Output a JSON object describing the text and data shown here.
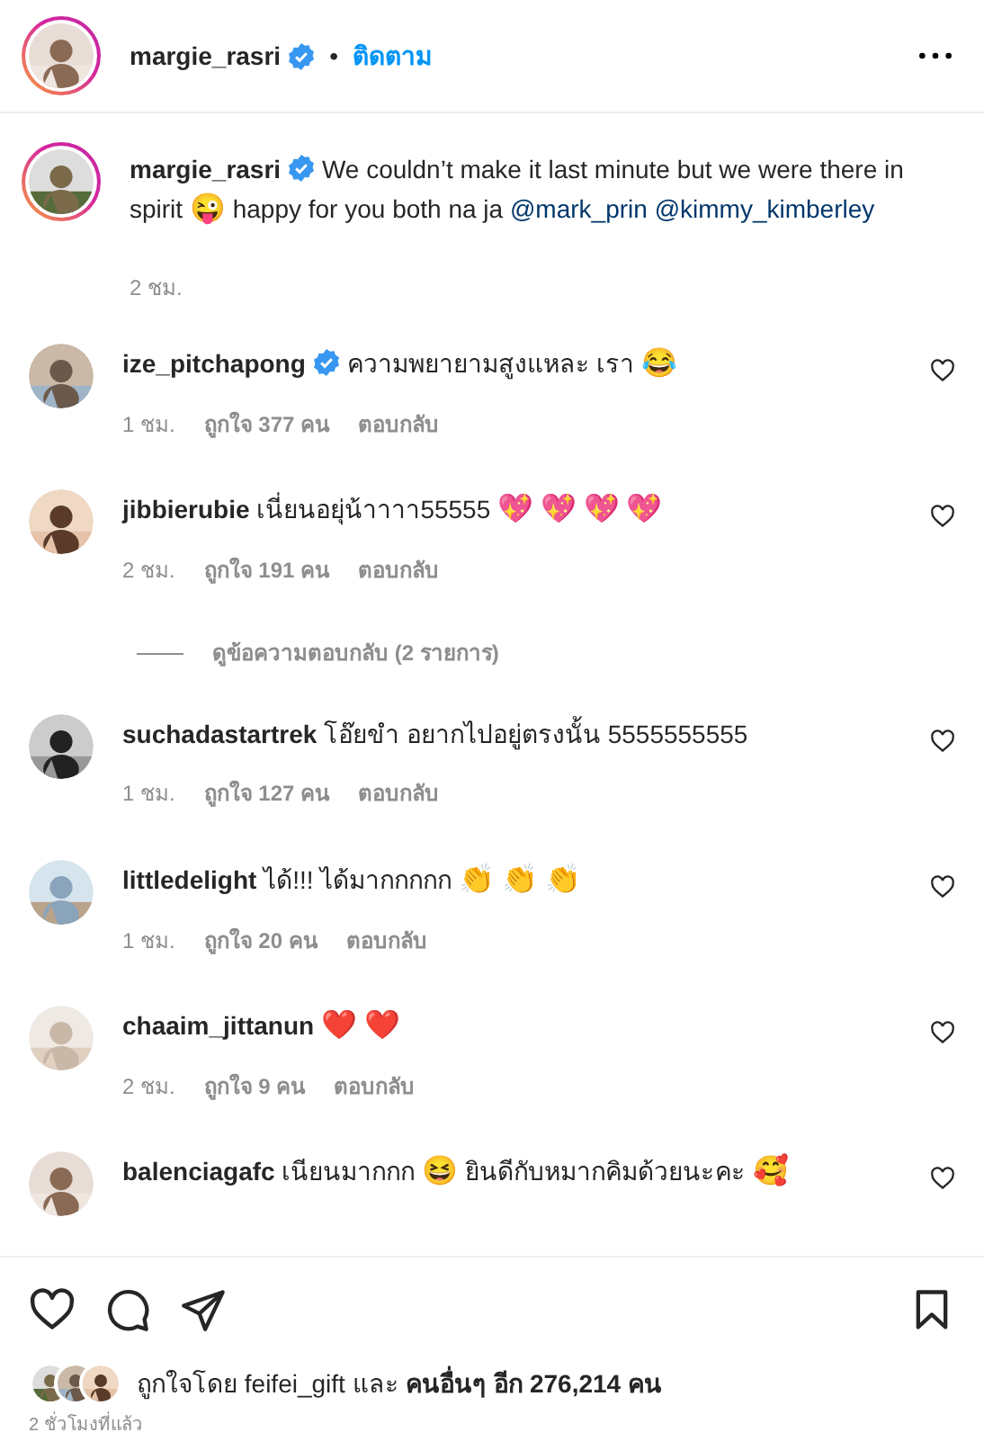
{
  "header": {
    "username": "margie_rasri",
    "verified": true,
    "separator": "•",
    "follow": "ติดตาม"
  },
  "caption": {
    "username": "margie_rasri",
    "verified": true,
    "parts": [
      {
        "kind": "text",
        "text": "We couldn’t make it last minute but we were there in spirit"
      },
      {
        "kind": "emoji",
        "emoji": "😜"
      },
      {
        "kind": "text",
        "text": "happy for you both na ja"
      },
      {
        "kind": "mention",
        "text": "@mark_prin"
      },
      {
        "kind": "mention",
        "text": "@kimmy_kimberley"
      }
    ],
    "time": "2 ชม."
  },
  "comments": [
    {
      "username": "ize_pitchapong",
      "verified": true,
      "parts": [
        {
          "kind": "text",
          "text": "ความพยายามสูงแหละ เรา"
        },
        {
          "kind": "emoji",
          "emoji": "😂"
        }
      ],
      "time": "1 ชม.",
      "likes": "ถูกใจ 377 คน",
      "reply": "ตอบกลับ"
    },
    {
      "username": "jibbierubie",
      "verified": false,
      "parts": [
        {
          "kind": "text",
          "text": "เนี่ยนอยุ่น้าาาา55555"
        },
        {
          "kind": "emoji",
          "emoji": "💖"
        },
        {
          "kind": "emoji",
          "emoji": "💖"
        },
        {
          "kind": "emoji",
          "emoji": "💖"
        },
        {
          "kind": "emoji",
          "emoji": "💖"
        }
      ],
      "time": "2 ชม.",
      "likes": "ถูกใจ 191 คน",
      "reply": "ตอบกลับ",
      "view_replies": "ดูข้อความตอบกลับ (2 รายการ)"
    },
    {
      "username": "suchadastartrek",
      "verified": false,
      "parts": [
        {
          "kind": "text",
          "text": "โอ๊ยขำ อยากไปอยู่ตรงนั้น 5555555555"
        }
      ],
      "time": "1 ชม.",
      "likes": "ถูกใจ 127 คน",
      "reply": "ตอบกลับ"
    },
    {
      "username": "littledelight",
      "verified": false,
      "parts": [
        {
          "kind": "text",
          "text": "ได้!!! ได้มากกกกก"
        },
        {
          "kind": "emoji",
          "emoji": "👏"
        },
        {
          "kind": "emoji",
          "emoji": "👏"
        },
        {
          "kind": "emoji",
          "emoji": "👏"
        }
      ],
      "time": "1 ชม.",
      "likes": "ถูกใจ 20 คน",
      "reply": "ตอบกลับ"
    },
    {
      "username": "chaaim_jittanun",
      "verified": false,
      "parts": [
        {
          "kind": "emoji",
          "emoji": "❤️"
        },
        {
          "kind": "emoji",
          "emoji": "❤️"
        }
      ],
      "time": "2 ชม.",
      "likes": "ถูกใจ 9 คน",
      "reply": "ตอบกลับ"
    },
    {
      "username": "balenciagafc",
      "verified": false,
      "parts": [
        {
          "kind": "text",
          "text": "เนียนมากกก"
        },
        {
          "kind": "emoji",
          "emoji": "😆"
        },
        {
          "kind": "text",
          "text": "ยินดีกับหมากคิมด้วยนะคะ"
        },
        {
          "kind": "emoji",
          "emoji": "🥰"
        }
      ]
    }
  ],
  "likes": {
    "text": "ถูกใจโดย feifei_gift และ **คนอื่นๆ อีก 276,214 คน**"
  },
  "time_ago": "2 ชั่วโมงที่แล้ว"
}
